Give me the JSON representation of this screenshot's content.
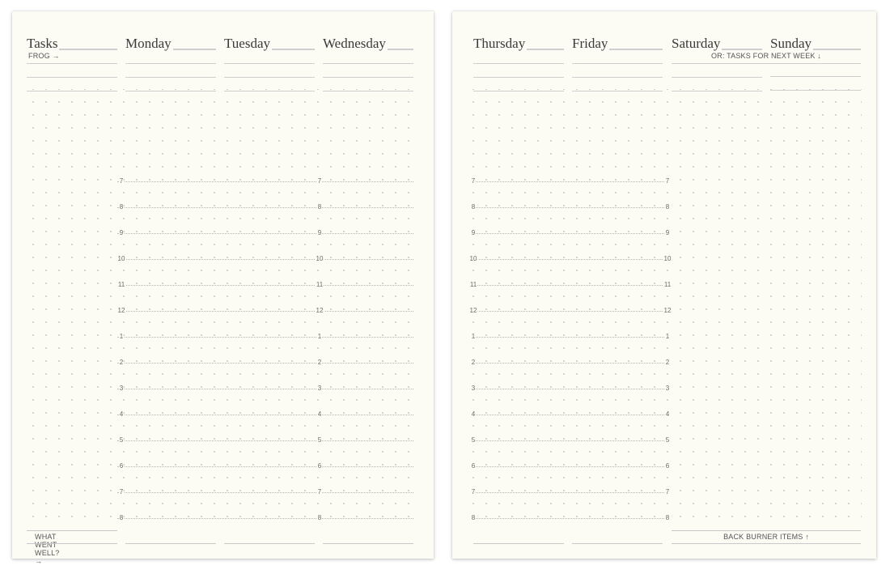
{
  "left_page": {
    "columns": [
      {
        "title": "Tasks",
        "first_row_label": "FROG →"
      },
      {
        "title": "Monday",
        "first_row_label": ""
      },
      {
        "title": "Tuesday",
        "first_row_label": ""
      },
      {
        "title": "Wednesday",
        "first_row_label": ""
      }
    ],
    "hours": [
      "7",
      "8",
      "9",
      "10",
      "11",
      "12",
      "1",
      "2",
      "3",
      "4",
      "5",
      "6",
      "7",
      "8"
    ],
    "footer_label": "WHAT WENT WELL? →"
  },
  "right_page": {
    "columns": [
      {
        "title": "Thursday"
      },
      {
        "title": "Friday"
      },
      {
        "title": "Saturday"
      },
      {
        "title": "Sunday"
      }
    ],
    "weekend_note": "OR: TASKS FOR NEXT WEEK ↓",
    "hours": [
      "7",
      "8",
      "9",
      "10",
      "11",
      "12",
      "1",
      "2",
      "3",
      "4",
      "5",
      "6",
      "7",
      "8"
    ],
    "footer_label": "BACK BURNER ITEMS ↑"
  }
}
